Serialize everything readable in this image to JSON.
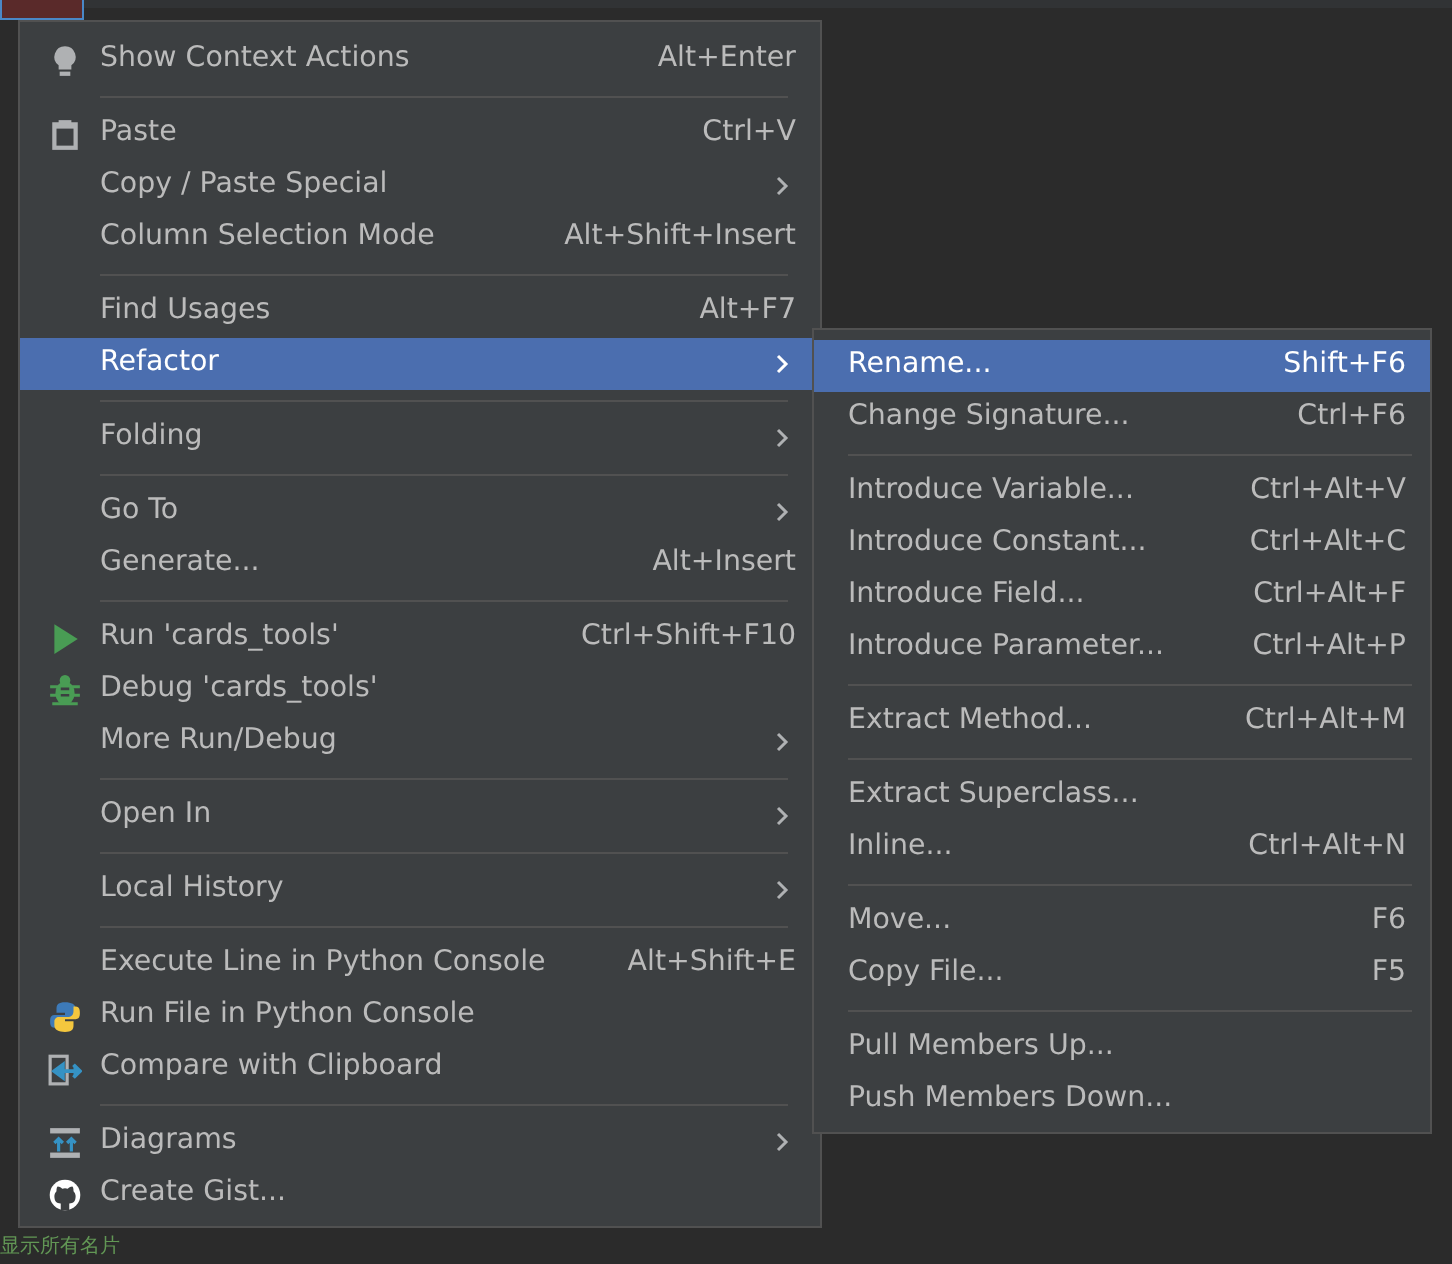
{
  "editor": {
    "comment": "显示所有名片"
  },
  "context_menu": {
    "items": [
      {
        "kind": "bulb",
        "label": "Show Context Actions",
        "shortcut": "Alt+Enter",
        "submenu": false,
        "selected": false
      },
      {
        "kind": "separator"
      },
      {
        "kind": "clipboard",
        "label": "Paste",
        "shortcut": "Ctrl+V",
        "submenu": false,
        "selected": false
      },
      {
        "kind": "item",
        "label": "Copy / Paste Special",
        "submenu": true,
        "selected": false
      },
      {
        "kind": "item",
        "label": "Column Selection Mode",
        "shortcut": "Alt+Shift+Insert",
        "submenu": false,
        "selected": false
      },
      {
        "kind": "separator"
      },
      {
        "kind": "item",
        "label": "Find Usages",
        "shortcut": "Alt+F7",
        "submenu": false,
        "selected": false
      },
      {
        "kind": "item",
        "label": "Refactor",
        "submenu": true,
        "selected": true
      },
      {
        "kind": "separator"
      },
      {
        "kind": "item",
        "label": "Folding",
        "submenu": true,
        "selected": false
      },
      {
        "kind": "separator"
      },
      {
        "kind": "item",
        "label": "Go To",
        "submenu": true,
        "selected": false
      },
      {
        "kind": "item",
        "label": "Generate...",
        "shortcut": "Alt+Insert",
        "submenu": false,
        "selected": false
      },
      {
        "kind": "separator"
      },
      {
        "kind": "run",
        "label": "Run 'cards_tools'",
        "shortcut": "Ctrl+Shift+F10",
        "submenu": false,
        "selected": false
      },
      {
        "kind": "debug",
        "label": "Debug 'cards_tools'",
        "submenu": false,
        "selected": false
      },
      {
        "kind": "item",
        "label": "More Run/Debug",
        "submenu": true,
        "selected": false
      },
      {
        "kind": "separator"
      },
      {
        "kind": "item",
        "label": "Open In",
        "submenu": true,
        "selected": false
      },
      {
        "kind": "separator"
      },
      {
        "kind": "item",
        "label": "Local History",
        "submenu": true,
        "selected": false
      },
      {
        "kind": "separator"
      },
      {
        "kind": "item",
        "label": "Execute Line in Python Console",
        "shortcut": "Alt+Shift+E",
        "submenu": false,
        "selected": false
      },
      {
        "kind": "python",
        "label": "Run File in Python Console",
        "submenu": false,
        "selected": false
      },
      {
        "kind": "compare",
        "label": "Compare with Clipboard",
        "submenu": false,
        "selected": false
      },
      {
        "kind": "separator"
      },
      {
        "kind": "diagrams",
        "label": "Diagrams",
        "submenu": true,
        "selected": false
      },
      {
        "kind": "github",
        "label": "Create Gist...",
        "submenu": false,
        "selected": false
      }
    ]
  },
  "refactor_submenu": {
    "items": [
      {
        "kind": "item",
        "label": "Rename...",
        "shortcut": "Shift+F6",
        "selected": true
      },
      {
        "kind": "item",
        "label": "Change Signature...",
        "shortcut": "Ctrl+F6",
        "selected": false
      },
      {
        "kind": "separator"
      },
      {
        "kind": "item",
        "label": "Introduce Variable...",
        "shortcut": "Ctrl+Alt+V",
        "selected": false
      },
      {
        "kind": "item",
        "label": "Introduce Constant...",
        "shortcut": "Ctrl+Alt+C",
        "selected": false
      },
      {
        "kind": "item",
        "label": "Introduce Field...",
        "shortcut": "Ctrl+Alt+F",
        "selected": false
      },
      {
        "kind": "item",
        "label": "Introduce Parameter...",
        "shortcut": "Ctrl+Alt+P",
        "selected": false
      },
      {
        "kind": "separator"
      },
      {
        "kind": "item",
        "label": "Extract Method...",
        "shortcut": "Ctrl+Alt+M",
        "selected": false
      },
      {
        "kind": "separator"
      },
      {
        "kind": "item",
        "label": "Extract Superclass...",
        "selected": false
      },
      {
        "kind": "item",
        "label": "Inline...",
        "shortcut": "Ctrl+Alt+N",
        "selected": false
      },
      {
        "kind": "separator"
      },
      {
        "kind": "item",
        "label": "Move...",
        "shortcut": "F6",
        "selected": false
      },
      {
        "kind": "item",
        "label": "Copy File...",
        "shortcut": "F5",
        "selected": false
      },
      {
        "kind": "separator"
      },
      {
        "kind": "item",
        "label": "Pull Members Up...",
        "selected": false
      },
      {
        "kind": "item",
        "label": "Push Members Down...",
        "selected": false
      }
    ]
  }
}
